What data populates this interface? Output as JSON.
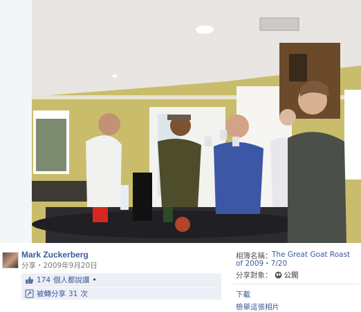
{
  "photo": {
    "alt_subject": "party-toast-photo"
  },
  "author": {
    "name": "Mark Zuckerberg",
    "shared_line": "分享・2009年9月20日"
  },
  "actions": {
    "likes_count": "174",
    "likes_text": "個人都說讚",
    "likes_bullet": "•",
    "shares_prefix": "被轉分享",
    "shares_count": "31",
    "shares_suffix": "次"
  },
  "meta": {
    "album_label": "相簿名稱：",
    "album_name": "The Great Goat Roast of 2009・7/20",
    "audience_label": "分享對象：",
    "audience_value": "公開",
    "download": "下載",
    "report": "檢舉這張相片"
  },
  "colors": {
    "link": "#3b5998",
    "action_bg": "#eceff5"
  }
}
